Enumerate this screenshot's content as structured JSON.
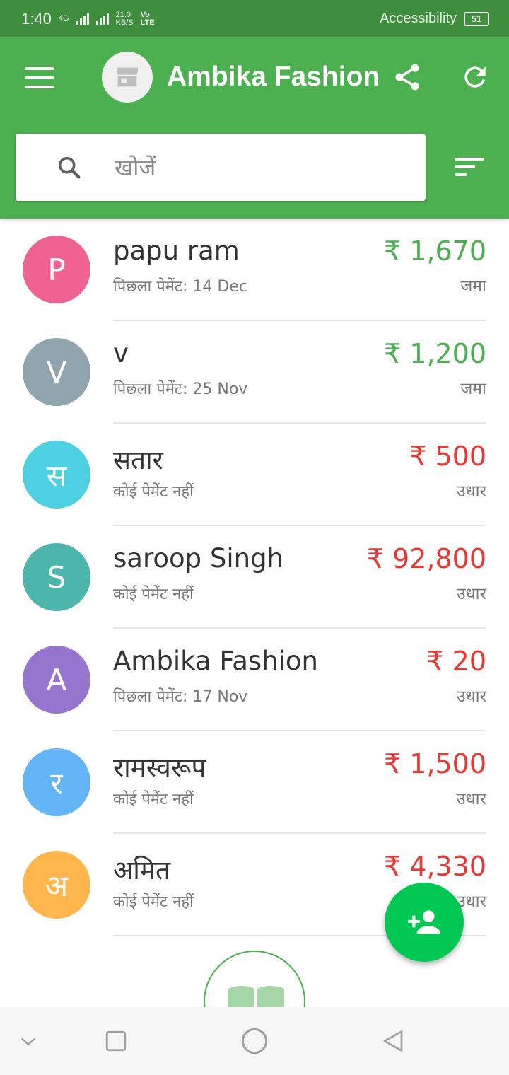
{
  "status_bar": {
    "time": "1:40",
    "network_type": "4G",
    "data_speed": "21.0",
    "data_speed_unit": "KB/S",
    "carrier": "Vo LTE",
    "accessibility_label": "Accessibility",
    "battery": "51"
  },
  "app_bar": {
    "title": "Ambika Fashion",
    "store_icon": "store-icon",
    "share_icon": "share-icon",
    "refresh_icon": "refresh-icon",
    "menu_icon": "menu-icon"
  },
  "search": {
    "placeholder": "खोजें",
    "value": "",
    "sort_icon": "sort-icon"
  },
  "colors": {
    "primary": "#4caf50",
    "status_bar": "#3e8e3e",
    "credit": "#4caf50",
    "debit": "#e53935",
    "fab": "#00c853"
  },
  "customers": [
    {
      "initial": "P",
      "name": "papu ram",
      "subtitle": "पिछला पेमेंट: 14 Dec",
      "amount": "₹ 1,670",
      "status": "जमा",
      "type": "credit",
      "avatar_color": "#f06292"
    },
    {
      "initial": "V",
      "name": "v",
      "subtitle": "पिछला पेमेंट: 25 Nov",
      "amount": "₹ 1,200",
      "status": "जमा",
      "type": "credit",
      "avatar_color": "#90a4ae"
    },
    {
      "initial": "स",
      "name": "सतार",
      "subtitle": "कोई पेमेंट नहीं",
      "amount": "₹ 500",
      "status": "उधार",
      "type": "debit",
      "avatar_color": "#4dd0e1"
    },
    {
      "initial": "S",
      "name": "saroop Singh",
      "subtitle": "कोई पेमेंट नहीं",
      "amount": "₹ 92,800",
      "status": "उधार",
      "type": "debit",
      "avatar_color": "#4db6ac"
    },
    {
      "initial": "A",
      "name": "Ambika Fashion",
      "subtitle": "पिछला पेमेंट: 17 Nov",
      "amount": "₹ 20",
      "status": "उधार",
      "type": "debit",
      "avatar_color": "#9575cd"
    },
    {
      "initial": "र",
      "name": "रामस्वरूप",
      "subtitle": "कोई पेमेंट नहीं",
      "amount": "₹ 1,500",
      "status": "उधार",
      "type": "debit",
      "avatar_color": "#64b5f6"
    },
    {
      "initial": "अ",
      "name": "अमित",
      "subtitle": "कोई पेमेंट नहीं",
      "amount": "₹ 4,330",
      "status": "उधार",
      "type": "debit",
      "avatar_color": "#ffb74d"
    }
  ],
  "fab": {
    "icon": "add-person-icon"
  },
  "book_button": {
    "icon": "book-icon"
  },
  "nav_bar": {
    "items": [
      "chevron-down-icon",
      "recents-icon",
      "home-icon",
      "back-icon"
    ]
  }
}
